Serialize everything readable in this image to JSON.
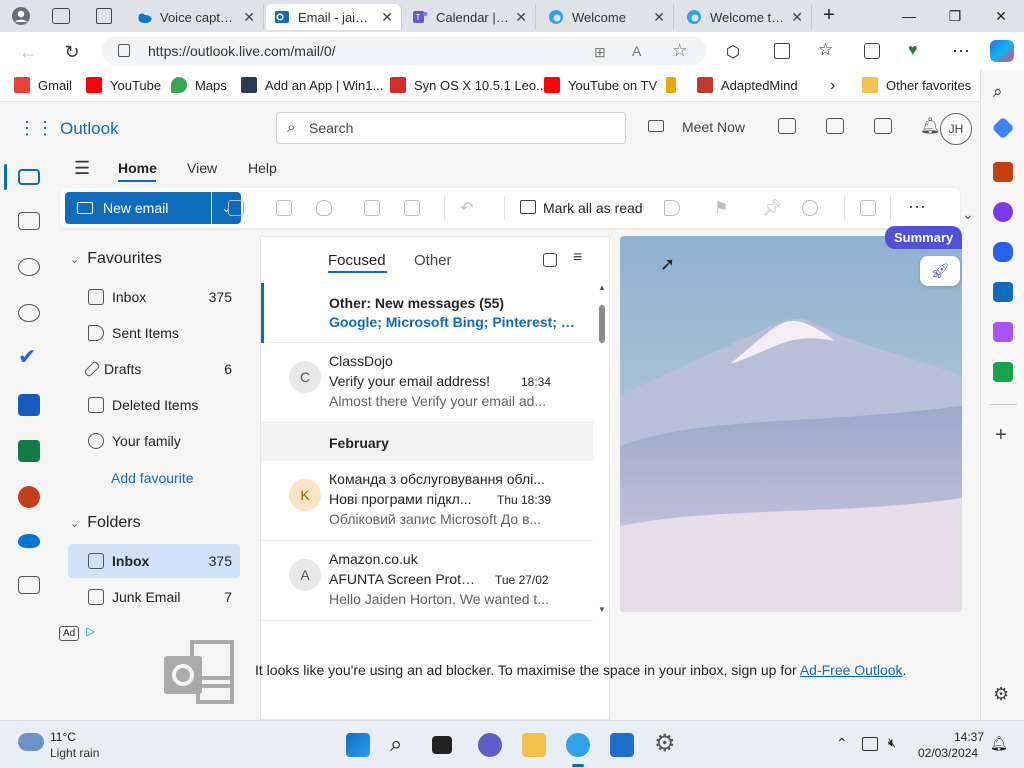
{
  "browser": {
    "tabs": [
      {
        "label": "Voice capture",
        "active": false
      },
      {
        "label": "Email - jaiden",
        "active": true
      },
      {
        "label": "Calendar | Mi",
        "active": false
      },
      {
        "label": "Welcome",
        "active": false
      },
      {
        "label": "Welcome to f",
        "active": false
      }
    ],
    "url": "https://outlook.live.com/mail/0/",
    "favorites": [
      {
        "label": "Gmail",
        "color": "#ea4335"
      },
      {
        "label": "YouTube",
        "color": "#ff0000"
      },
      {
        "label": "Maps",
        "color": "#34a853"
      },
      {
        "label": "Add an App | Win1...",
        "color": "#2a3b55"
      },
      {
        "label": "Syn OS X 10.5.1 Leo...",
        "color": "#d62b2b"
      },
      {
        "label": "YouTube on TV",
        "color": "#ff0000"
      },
      {
        "label": "",
        "color": "#f0a500"
      },
      {
        "label": "AdaptedMind",
        "color": "#c0392b"
      }
    ],
    "other_favorites": "Other favorites"
  },
  "outlook": {
    "brand": "Outlook",
    "search_placeholder": "Search",
    "meet_now": "Meet Now",
    "avatar_initials": "JH",
    "nav_tabs": [
      "Home",
      "View",
      "Help"
    ],
    "new_email": "New email",
    "mark_all_read": "Mark all as read",
    "favourites_header": "Favourites",
    "favourites": [
      {
        "label": "Inbox",
        "count": "375"
      },
      {
        "label": "Sent Items",
        "count": ""
      },
      {
        "label": "Drafts",
        "count": "6"
      },
      {
        "label": "Deleted Items",
        "count": ""
      },
      {
        "label": "Your family",
        "count": ""
      }
    ],
    "add_favourite": "Add favourite",
    "folders_header": "Folders",
    "folders": [
      {
        "label": "Inbox",
        "count": "375"
      },
      {
        "label": "Junk Email",
        "count": "7"
      }
    ],
    "ad_badge": "Ad",
    "list_tabs": {
      "focused": "Focused",
      "other": "Other"
    },
    "other_banner": {
      "title": "Other: New messages (55)",
      "senders": "Google; Microsoft Bing; Pinterest; Ma..."
    },
    "messages": [
      {
        "initial": "C",
        "sender": "ClassDojo",
        "subject": "Verify your email address!",
        "time": "18:34",
        "preview": "Almost there Verify your email ad..."
      },
      {
        "initial": "K",
        "sender": "Команда з обслуговування облі...",
        "subject": "Нові програми підкл...",
        "time": "Thu 18:39",
        "preview": "Обліковий запис Microsoft До в..."
      },
      {
        "initial": "A",
        "sender": "Amazon.co.uk",
        "subject": "AFUNTA Screen Protec...",
        "time": "Tue 27/02",
        "preview": "Hello Jaiden Horton, We wanted t..."
      }
    ],
    "group_header": "February",
    "summary_label": "Summary",
    "adblock_text": "It looks like you're using an ad blocker. To maximise the space in your inbox, sign up for",
    "adblock_link": "Ad-Free Outlook",
    "adblock_end": "."
  },
  "taskbar": {
    "weather_temp": "11°C",
    "weather_desc": "Light rain",
    "time": "14:37",
    "date": "02/03/2024"
  },
  "colors": {
    "accent": "#0f6cbd",
    "selected": "#cfe4fa"
  }
}
